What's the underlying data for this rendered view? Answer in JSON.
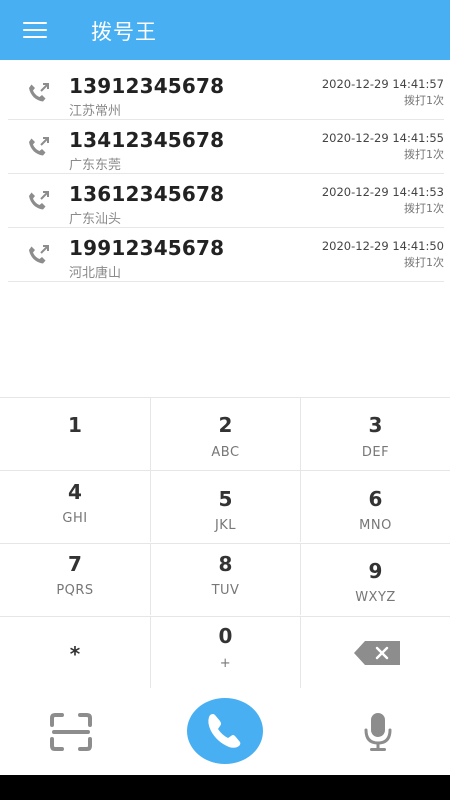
{
  "header": {
    "menu_icon": "menu-icon",
    "title": "拨号王"
  },
  "call_log": [
    {
      "number": "13912345678",
      "location": "江苏常州",
      "time": "2020-12-29 14:41:57",
      "count": "拨打1次",
      "icon": "outgoing-call-icon"
    },
    {
      "number": "13412345678",
      "location": "广东东莞",
      "time": "2020-12-29 14:41:55",
      "count": "拨打1次",
      "icon": "outgoing-call-icon"
    },
    {
      "number": "13612345678",
      "location": "广东汕头",
      "time": "2020-12-29 14:41:53",
      "count": "拨打1次",
      "icon": "outgoing-call-icon"
    },
    {
      "number": "19912345678",
      "location": "河北唐山",
      "time": "2020-12-29 14:41:50",
      "count": "拨打1次",
      "icon": "outgoing-call-icon"
    }
  ],
  "keypad": {
    "keys": [
      {
        "digit": "1",
        "letters": ""
      },
      {
        "digit": "2",
        "letters": "ABC"
      },
      {
        "digit": "3",
        "letters": "DEF"
      },
      {
        "digit": "4",
        "letters": "GHI"
      },
      {
        "digit": "5",
        "letters": "JKL"
      },
      {
        "digit": "6",
        "letters": "MNO"
      },
      {
        "digit": "7",
        "letters": "PQRS"
      },
      {
        "digit": "8",
        "letters": "TUV"
      },
      {
        "digit": "9",
        "letters": "WXYZ"
      },
      {
        "digit": "*",
        "letters": ""
      },
      {
        "digit": "0",
        "letters": "+"
      }
    ],
    "backspace_icon": "backspace-icon"
  },
  "bottom_bar": {
    "scan_icon": "scan-icon",
    "dial_icon": "phone-icon",
    "mic_icon": "microphone-icon"
  },
  "colors": {
    "accent": "#47aff2",
    "icon_gray": "#8d8d8d"
  }
}
